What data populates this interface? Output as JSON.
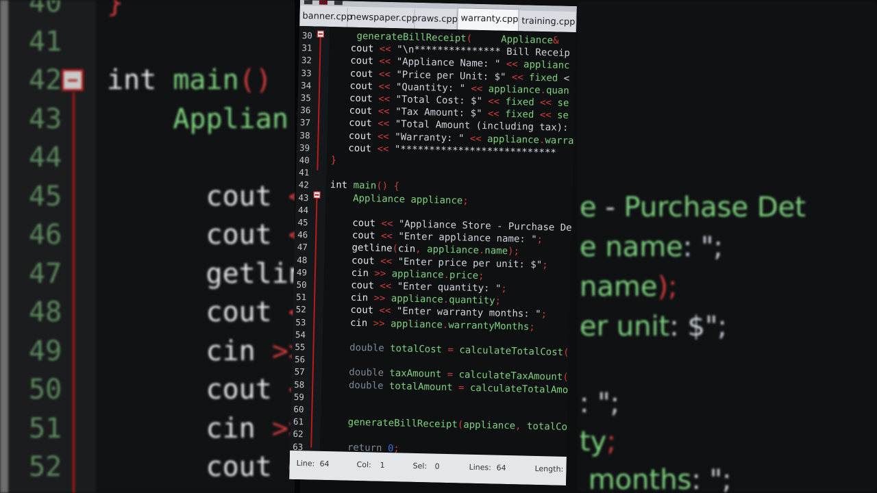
{
  "tabs": [
    {
      "label": "banner.cpp",
      "active": false
    },
    {
      "label": "newspaper.cpp",
      "active": false
    },
    {
      "label": "raws.cpp",
      "active": false
    },
    {
      "label": "warranty.cpp",
      "active": true
    },
    {
      "label": "training.cpp",
      "active": false
    }
  ],
  "code_lines": [
    {
      "n": "30",
      "text": "    generateBillReceipt(     Appliance&"
    },
    {
      "n": "31",
      "text": "   cout << \"\\n*************** Bill Receip"
    },
    {
      "n": "32",
      "text": "   cout << \"Appliance Name: \" << applianc"
    },
    {
      "n": "33",
      "text": "   cout << \"Price per Unit: $\" << fixed <"
    },
    {
      "n": "34",
      "text": "   cout << \"Quantity: \" << appliance.quan"
    },
    {
      "n": "35",
      "text": "   cout << \"Total Cost: $\" << fixed << se"
    },
    {
      "n": "36",
      "text": "   cout << \"Tax Amount: $\" << fixed << se"
    },
    {
      "n": "37",
      "text": "   cout << \"Total Amount (including tax):"
    },
    {
      "n": "38",
      "text": "   cout << \"Warranty: \" << appliance.warra"
    },
    {
      "n": "39",
      "text": "   cout << \"***************************"
    },
    {
      "n": "40",
      "text": "}"
    },
    {
      "n": "41",
      "text": ""
    },
    {
      "n": "42",
      "text": "int main() {"
    },
    {
      "n": "43",
      "text": "    Appliance appliance;"
    },
    {
      "n": "44",
      "text": ""
    },
    {
      "n": "45",
      "text": "    cout << \"Appliance Store - Purchase Det"
    },
    {
      "n": "46",
      "text": "    cout << \"Enter appliance name: \";"
    },
    {
      "n": "47",
      "text": "    getline(cin, appliance.name);"
    },
    {
      "n": "48",
      "text": "    cout << \"Enter price per unit: $\";"
    },
    {
      "n": "49",
      "text": "    cin >> appliance.price;"
    },
    {
      "n": "50",
      "text": "    cout << \"Enter quantity: \";"
    },
    {
      "n": "51",
      "text": "    cin >> appliance.quantity;"
    },
    {
      "n": "52",
      "text": "    cout << \"Enter warranty months: \";"
    },
    {
      "n": "53",
      "text": "    cin >> appliance.warrantyMonths;"
    },
    {
      "n": "54",
      "text": ""
    },
    {
      "n": "55",
      "text": "    double totalCost = calculateTotalCost(ap"
    },
    {
      "n": "56",
      "text": ""
    },
    {
      "n": "57",
      "text": "    double taxAmount = calculateTaxAmount(to"
    },
    {
      "n": "58",
      "text": "    double totalAmount = calculateTotalAmoun"
    },
    {
      "n": "59",
      "text": ""
    },
    {
      "n": "60",
      "text": ""
    },
    {
      "n": "61",
      "text": "    generateBillReceipt(appliance, totalCost"
    },
    {
      "n": "62",
      "text": ""
    },
    {
      "n": "63",
      "text": "    return 0;"
    }
  ],
  "status": {
    "line_label": "Line:",
    "line_value": "64",
    "col_label": "Col:",
    "col_value": "1",
    "sel_label": "Sel:",
    "sel_value": "0",
    "lines_label": "Lines:",
    "lines_value": "64",
    "length_label": "Length:"
  },
  "background_left": {
    "lines": [
      {
        "n": "40",
        "text": "}"
      },
      {
        "n": "41",
        "text": ""
      },
      {
        "n": "42",
        "text": "int main()"
      },
      {
        "n": "43",
        "text": "    Applian"
      },
      {
        "n": "44",
        "text": ""
      },
      {
        "n": "45",
        "text": "      cout <<"
      },
      {
        "n": "46",
        "text": "      cout <<"
      },
      {
        "n": "47",
        "text": "      getline"
      },
      {
        "n": "48",
        "text": "      cout <<"
      },
      {
        "n": "49",
        "text": "      cin >>"
      },
      {
        "n": "50",
        "text": "      cout <<"
      },
      {
        "n": "51",
        "text": "      cin >>"
      },
      {
        "n": "52",
        "text": "      cout <<"
      }
    ]
  },
  "background_right": {
    "lines": [
      {
        "text": "e - Purchase Det"
      },
      {
        "text": "e name: \";"
      },
      {
        "text": "name);"
      },
      {
        "text": "er unit: $\";"
      },
      {
        "text": ": \";"
      },
      {
        "text": "ty;"
      },
      {
        "text": " months: \";"
      }
    ]
  },
  "colors": {
    "keyword": "#e6e6e6",
    "operator": "#d23b3b",
    "string": "#cfd6dc",
    "identifier": "#7ed37e",
    "fold_marker": "#c01818",
    "tab_active_bg": "#f4f6f8"
  }
}
